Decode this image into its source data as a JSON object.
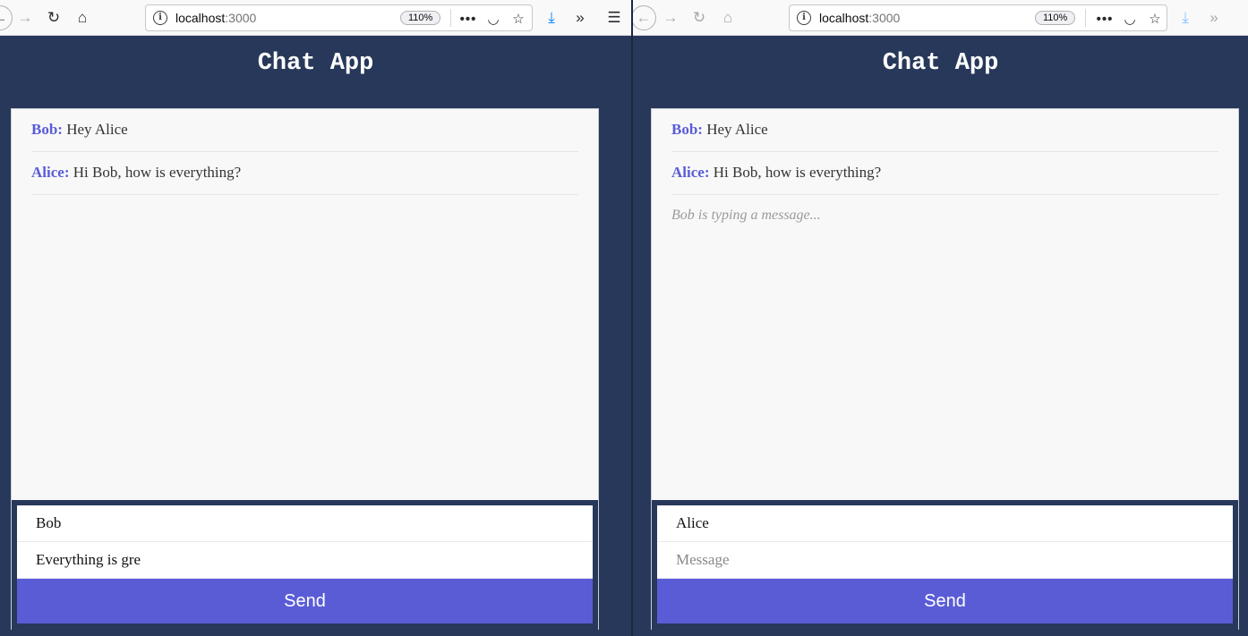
{
  "windows": [
    {
      "browser": {
        "url_host": "localhost",
        "url_port": ":3000",
        "zoom": "110%"
      },
      "app_title": "Chat App",
      "messages": [
        {
          "author": "Bob:",
          "text": "Hey Alice"
        },
        {
          "author": "Alice:",
          "text": "Hi Bob, how is everything?"
        }
      ],
      "typing_indicator": "",
      "composer": {
        "name_value": "Bob",
        "message_value": "Everything is gre",
        "message_placeholder": "Message",
        "send_label": "Send"
      }
    },
    {
      "browser": {
        "url_host": "localhost",
        "url_port": ":3000",
        "zoom": "110%"
      },
      "app_title": "Chat App",
      "messages": [
        {
          "author": "Bob:",
          "text": "Hey Alice"
        },
        {
          "author": "Alice:",
          "text": "Hi Bob, how is everything?"
        }
      ],
      "typing_indicator": "Bob is typing a message...",
      "composer": {
        "name_value": "Alice",
        "message_value": "",
        "message_placeholder": "Message",
        "send_label": "Send"
      }
    }
  ],
  "colors": {
    "background": "#27385a",
    "accent": "#5a5cd6",
    "panel": "#f8f8f9"
  },
  "icons": [
    "back-icon",
    "forward-icon",
    "reload-icon",
    "home-icon",
    "info-icon",
    "more-icon",
    "pocket-icon",
    "bookmark-star-icon",
    "download-icon",
    "overflow-icon",
    "hamburger-menu-icon"
  ]
}
